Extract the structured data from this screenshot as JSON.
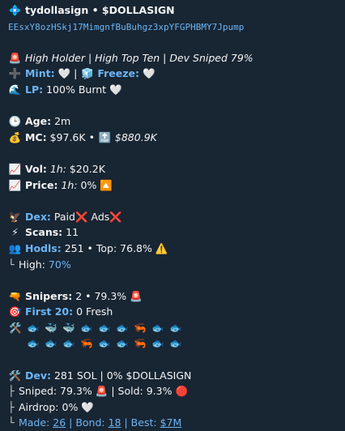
{
  "header": {
    "icon": "💠",
    "title": "tydollasign • $DOLLASIGN",
    "address": "EEsxY8ozHSkj17MimgnfBuBuhgz3xpYFGPHBMY7Jpump"
  },
  "warnings": {
    "icon": "🚨",
    "text": "High Holder | High Top Ten | Dev Sniped 79%"
  },
  "mint": {
    "icon": "➕",
    "label": "Mint:",
    "value": "🤍",
    "sep": "|",
    "freeze_icon": "🧊",
    "freeze_label": "Freeze:",
    "freeze_value": "🤍"
  },
  "lp": {
    "icon": "🌊",
    "label": "LP:",
    "value": "100% Burnt",
    "heart": "🤍"
  },
  "age": {
    "icon": "🕒",
    "label": "Age:",
    "value": "2m"
  },
  "mc": {
    "icon": "💰",
    "label": "MC:",
    "value": "$97.6K",
    "sep": "•",
    "top_icon": "🔝",
    "top_value": "$880.9K"
  },
  "vol": {
    "icon": "📈",
    "label": "Vol:",
    "period": "1h:",
    "value": "$20.2K"
  },
  "price": {
    "icon": "📈",
    "label": "Price:",
    "period": "1h:",
    "value": "0%",
    "arrow": "🔼"
  },
  "dex": {
    "icon": "🦅",
    "label": "Dex:",
    "paid_text": "Paid",
    "paid_mark": "❌",
    "ads_text": "Ads",
    "ads_mark": "❌"
  },
  "scans": {
    "icon": "⚡",
    "label": "Scans:",
    "value": "11"
  },
  "hodls": {
    "icon": "👥",
    "label": "Hodls:",
    "value": "251 • Top: 76.8%",
    "warn": "⚠️"
  },
  "high": {
    "branch": "└",
    "label": "High:",
    "value": "70%"
  },
  "snipers": {
    "icon": "🔫",
    "label": "Snipers:",
    "value": "2 • 79.3%",
    "mark": "🚨"
  },
  "first20": {
    "icon": "🎯",
    "label": "First 20:",
    "value": "0 Fresh"
  },
  "swarm": {
    "icon": "🛠️",
    "row1": [
      "🐟",
      "🐳",
      "🐳",
      "🐟",
      "🐟",
      "🐟",
      "🦐",
      "🐟",
      "🐟"
    ],
    "row2": [
      "🐟",
      "🐟",
      "🐟",
      "🦐",
      "🐟",
      "🐟",
      "🦐",
      "🐟",
      "🐟"
    ]
  },
  "dev": {
    "icon": "🛠️",
    "label": "Dev:",
    "value": "281 SOL | 0% $DOLLASIGN",
    "sniped_branch": "├",
    "sniped_text": "Sniped: 79.3%",
    "sniped_mark": "🚨",
    "sold_text": "| Sold: 9.3%",
    "sold_mark": "🔴",
    "airdrop_branch": "├",
    "airdrop_text": "Airdrop: 0%",
    "airdrop_mark": "🤍",
    "made_branch": "└",
    "made_label": "Made:",
    "made_value": "26",
    "bond_sep": "| Bond:",
    "bond_value": "18",
    "best_sep": "| Best:",
    "best_value": "$7M"
  }
}
